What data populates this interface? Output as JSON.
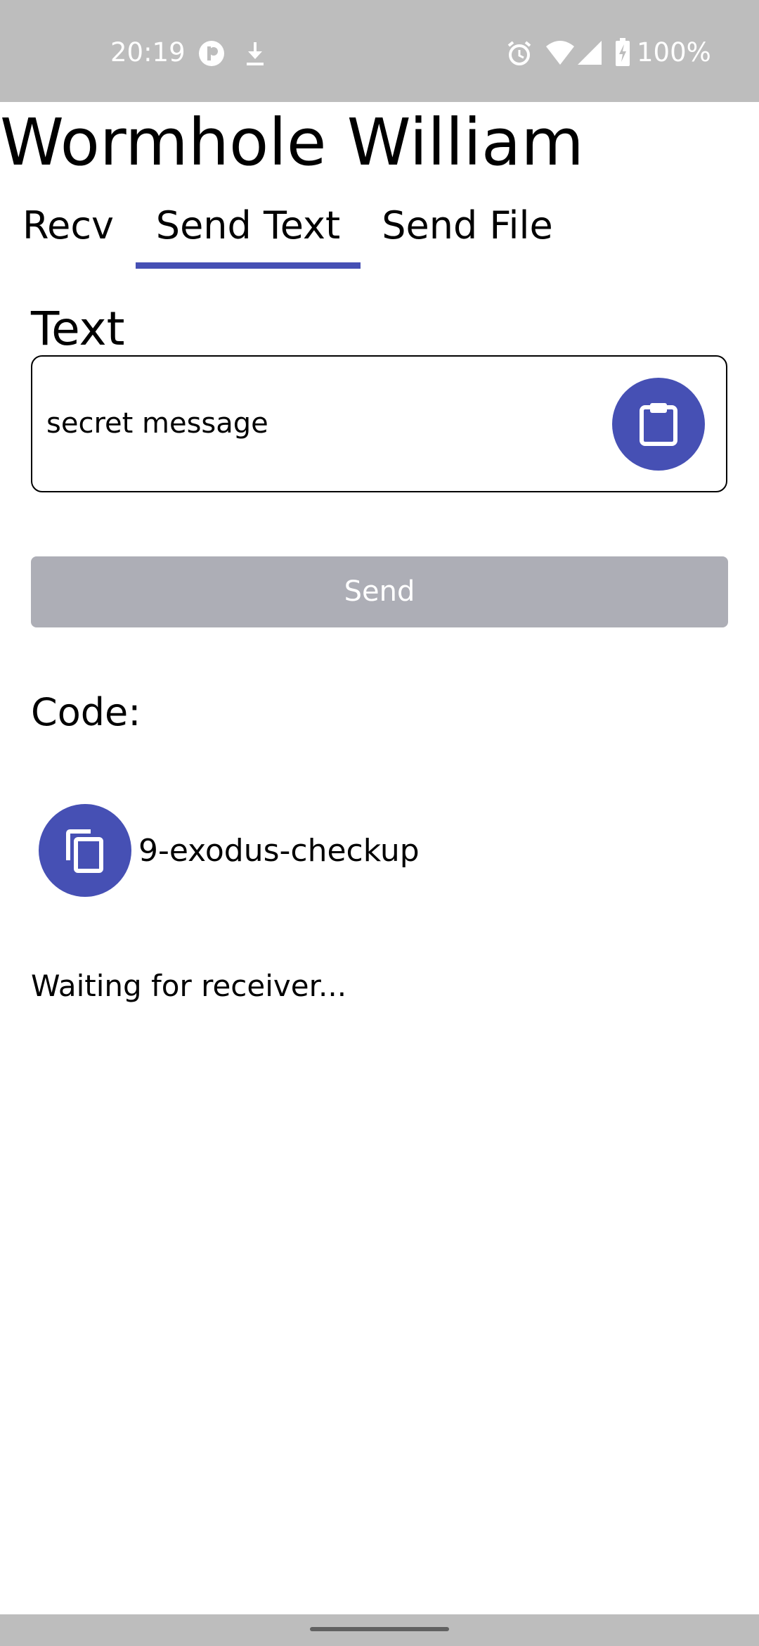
{
  "status_bar": {
    "time": "20:19",
    "battery_percent": "100%",
    "icons": [
      "app-notification-icon",
      "download-icon",
      "alarm-icon",
      "wifi-icon",
      "signal-icon",
      "battery-charging-icon"
    ]
  },
  "app": {
    "title": "Wormhole William"
  },
  "tabs": [
    {
      "label": "Recv",
      "selected": false
    },
    {
      "label": "Send Text",
      "selected": true
    },
    {
      "label": "Send File",
      "selected": false
    }
  ],
  "send_text": {
    "text_label": "Text",
    "text_value": "secret message",
    "paste_icon": "clipboard-icon",
    "send_label": "Send",
    "code_label": "Code:",
    "copy_icon": "copy-icon",
    "code_value": "9-exodus-checkup",
    "status": "Waiting for receiver..."
  },
  "colors": {
    "accent": "#4650b4",
    "disabled_button": "#adaeb6",
    "system_bars": "#bdbdbd"
  }
}
